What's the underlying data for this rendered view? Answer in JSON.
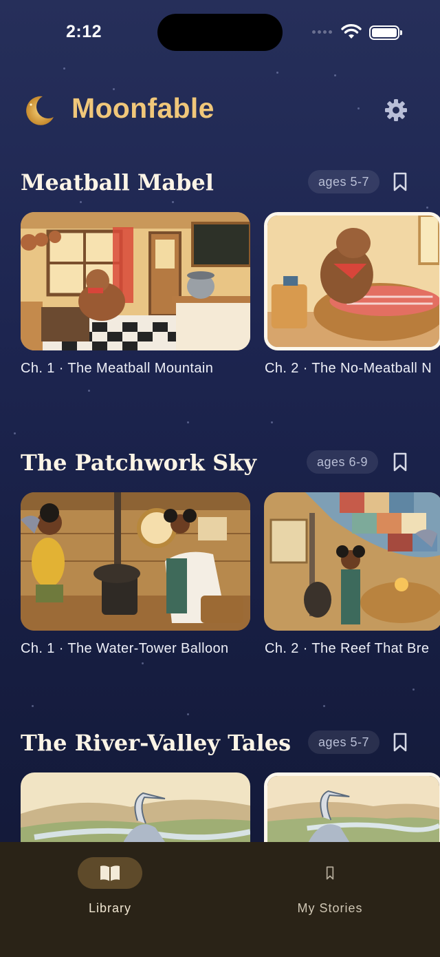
{
  "status_bar": {
    "time": "2:12"
  },
  "app": {
    "title": "Moonfable"
  },
  "icons": {
    "logo": "crescent-moon-icon",
    "settings": "gear-icon",
    "bookmark": "bookmark-icon",
    "library": "open-book-icon"
  },
  "colors": {
    "accent": "#f0c77a",
    "background": "#1d2550",
    "tab_bar": "#2a2317",
    "active_tab_pill": "#5e4a2a"
  },
  "sections": [
    {
      "title": "Meatball Mabel",
      "age": "ages 5-7",
      "chapters": [
        {
          "label": "Ch. 1 · The Meatball Mountain"
        },
        {
          "label": "Ch. 2 · The No-Meatball N"
        }
      ]
    },
    {
      "title": "The Patchwork Sky",
      "age": "ages 6-9",
      "chapters": [
        {
          "label": "Ch. 1 · The Water-Tower Balloon"
        },
        {
          "label": "Ch. 2 · The Reef That Bre"
        }
      ]
    },
    {
      "title": "The River-Valley Tales",
      "age": "ages 5-7",
      "chapters": [
        {
          "label": ""
        },
        {
          "label": ""
        }
      ]
    }
  ],
  "tab_bar": {
    "items": [
      {
        "label": "Library",
        "active": true
      },
      {
        "label": "My Stories",
        "active": false
      }
    ]
  }
}
